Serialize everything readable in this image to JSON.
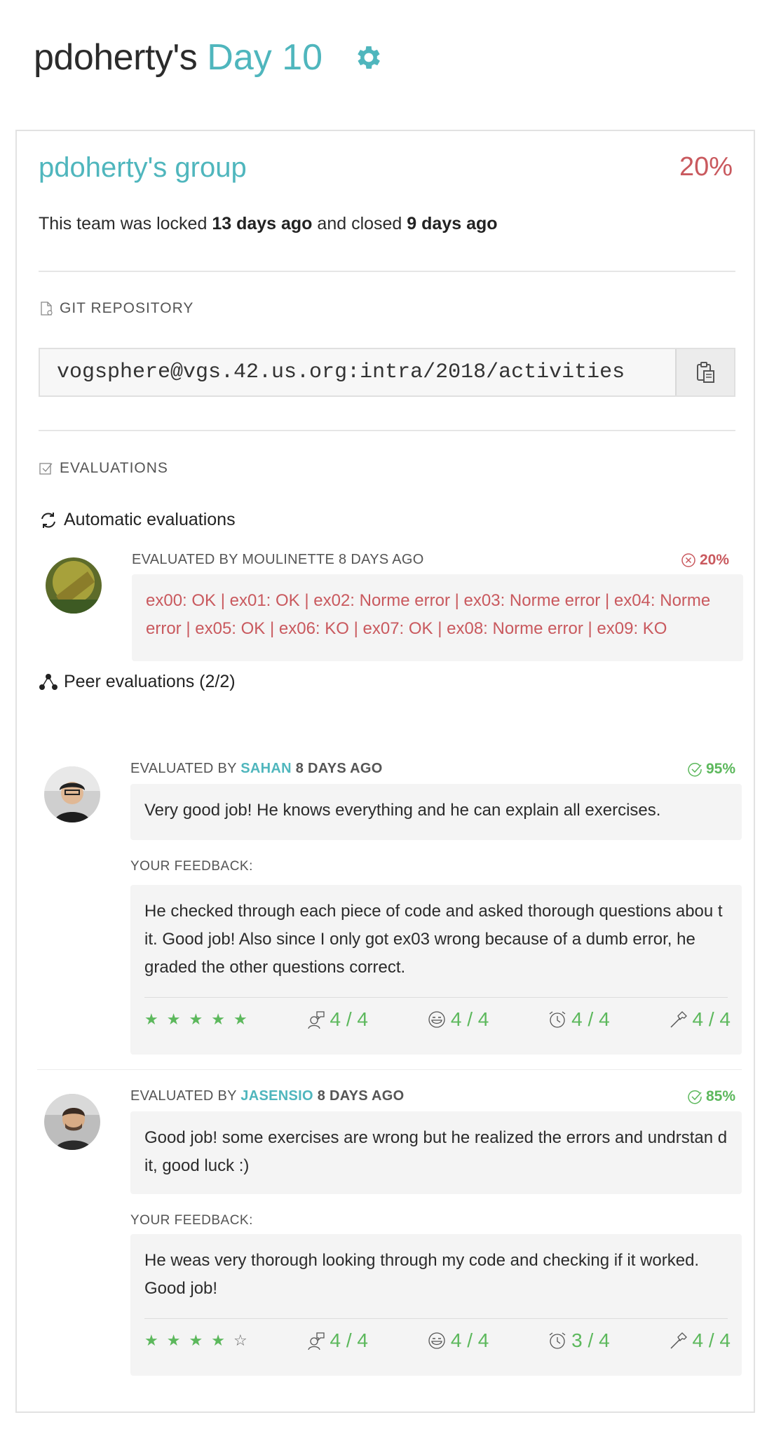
{
  "header": {
    "owner": "pdoherty's",
    "day": "Day 10",
    "settings_icon": "gear-icon"
  },
  "group": {
    "title": "pdoherty's group",
    "percentage": "20%",
    "locked_prefix": "This team was locked ",
    "locked_ago": "13 days ago",
    "closed_prefix": " and closed ",
    "closed_ago": "9 days ago"
  },
  "repository": {
    "label": "GIT REPOSITORY",
    "url": "vogsphere@vgs.42.us.org:intra/2018/activities",
    "copy_icon": "clipboard-icon"
  },
  "evaluations": {
    "label": "EVALUATIONS",
    "automatic": {
      "label": "Automatic evaluations",
      "meta": "EVALUATED BY MOULINETTE 8 DAYS AGO",
      "score": "20%",
      "result": "ex00: OK | ex01: OK | ex02: Norme error | ex03: Norme error | ex04: Norme error | ex05: OK | ex06: KO | ex07: OK | ex08: Norme error | ex09: KO"
    },
    "peer": {
      "label": "Peer evaluations (2/2)",
      "items": [
        {
          "meta_prefix": "EVALUATED BY ",
          "evaluator": "SAHAN",
          "ago": " 8 DAYS AGO",
          "score": "95%",
          "comment": "Very good job! He knows everything and he can explain all exercises.",
          "feedback_label": "YOUR FEEDBACK:",
          "feedback": "He checked through each piece of code and asked thorough questions abou t it. Good job! Also since I only got ex03 wrong because of a dumb error, he graded the other questions correct.",
          "stars": 5,
          "ratings": [
            "4 / 4",
            "4 / 4",
            "4 / 4",
            "4 / 4"
          ]
        },
        {
          "meta_prefix": "EVALUATED BY ",
          "evaluator": "JASENSIO",
          "ago": " 8 DAYS AGO",
          "score": "85%",
          "comment": "Good job! some exercises are wrong but he realized the errors and undrstan d it, good luck :)",
          "feedback_label": "YOUR FEEDBACK:",
          "feedback": "He weas very thorough looking through my code and checking if it worked. Good job!",
          "stars": 4,
          "ratings": [
            "4 / 4",
            "4 / 4",
            "3 / 4",
            "4 / 4"
          ]
        }
      ]
    }
  },
  "colors": {
    "accent": "#4fb6bd",
    "error": "#c9595e",
    "success": "#5cb85c"
  }
}
